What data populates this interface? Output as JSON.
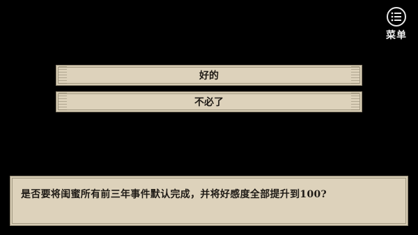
{
  "menu": {
    "label": "菜单",
    "icon": "menu-list-icon"
  },
  "choices": [
    {
      "label": "好的"
    },
    {
      "label": "不必了"
    }
  ],
  "dialog": {
    "text": "是否要将闺蜜所有前三年事件默认完成，并将好感度全部提升到100?"
  },
  "colors": {
    "background": "#000000",
    "panel": "#ddd2bb",
    "panel_border": "#8f8571",
    "text": "#1f1b16",
    "menu_fg": "#e9e9e9"
  }
}
